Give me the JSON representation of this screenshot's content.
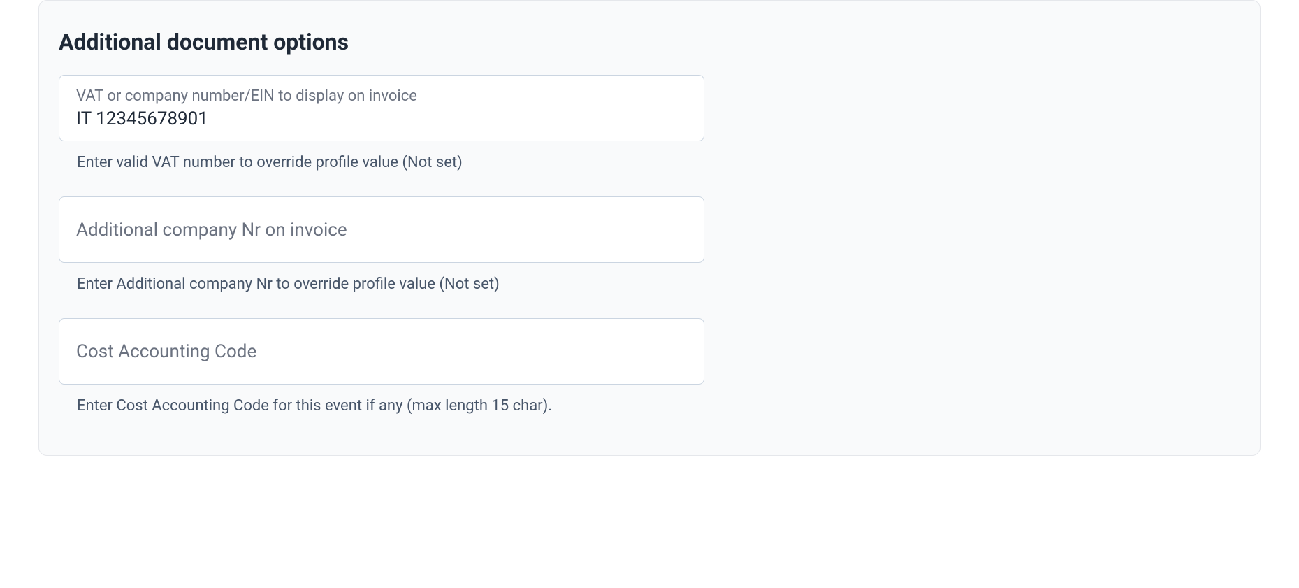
{
  "section": {
    "title": "Additional document options"
  },
  "fields": {
    "vat": {
      "label": "VAT or company number/EIN to display on invoice",
      "value": "IT 12345678901",
      "help": "Enter valid VAT number to override profile value (Not set)"
    },
    "company_nr": {
      "placeholder": "Additional company Nr on invoice",
      "value": "",
      "help": "Enter Additional company Nr to override profile value (Not set)"
    },
    "cost_code": {
      "placeholder": "Cost Accounting Code",
      "value": "",
      "help": "Enter Cost Accounting Code for this event if any (max length 15 char)."
    }
  }
}
